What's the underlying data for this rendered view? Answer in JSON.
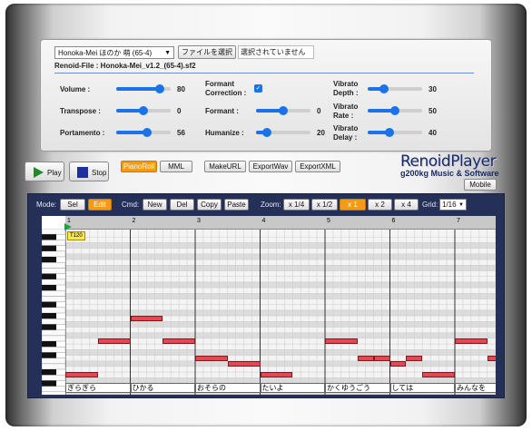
{
  "file": {
    "selected": "Honoka-Mei ほのか 萌 (65-4)",
    "choose_label": "ファイルを選択",
    "status": "選択されていません",
    "renoid_file": "Renoid-File : Honoka-Mei_v1.2_(65-4).sf2"
  },
  "params": [
    {
      "label": "Volume :",
      "value": "80",
      "level": 0.8
    },
    {
      "label": "Transpose :",
      "value": "0",
      "level": 0.5
    },
    {
      "label": "Portamento :",
      "value": "56",
      "level": 0.56
    },
    {
      "label": "Formant Correction :",
      "checked": true
    },
    {
      "label": "Formant :",
      "value": "0",
      "level": 0.5
    },
    {
      "label": "Humanize :",
      "value": "20",
      "level": 0.2
    },
    {
      "label": "Vibrato Depth :",
      "value": "30",
      "level": 0.3
    },
    {
      "label": "Vibrato Rate :",
      "value": "50",
      "level": 0.5
    },
    {
      "label": "Vibrato Delay :",
      "value": "40",
      "level": 0.4
    }
  ],
  "transport": {
    "play": "Play",
    "stop": "Stop"
  },
  "buttons": {
    "pianoroll": "PianoRoll",
    "mml": "MML",
    "makeurl": "MakeURL",
    "exportwav": "ExportWav",
    "exportxml": "ExportXML",
    "mobile": "Mobile"
  },
  "logo": {
    "title": "RenoidPlayer",
    "subtitle": "g200kg Music & Software"
  },
  "toolbar": {
    "mode_label": "Mode:",
    "mode_sel": "Sel",
    "mode_edit": "Edit",
    "cmd_label": "Cmd:",
    "new": "New",
    "del": "Del",
    "copy": "Copy",
    "paste": "Paste",
    "zoom_label": "Zoom:",
    "zoom": [
      "x 1/4",
      "x 1/2",
      "x 1",
      "x 2",
      "x 4"
    ],
    "zoom_active": 2,
    "grid_label": "Grid:",
    "grid_value": "1/16"
  },
  "roll": {
    "bars": [
      "1",
      "2",
      "3",
      "4",
      "5",
      "6",
      "7"
    ],
    "tempo": "T120",
    "octaves": [
      "C5",
      "C4"
    ],
    "notes": [
      {
        "bar": 1,
        "beat": 0,
        "len": 1,
        "pitch": "B3"
      },
      {
        "bar": 1,
        "beat": 1,
        "len": 1,
        "pitch": "F4"
      },
      {
        "bar": 2,
        "beat": 0,
        "len": 1,
        "pitch": "A4"
      },
      {
        "bar": 2,
        "beat": 1,
        "len": 1,
        "pitch": "F4"
      },
      {
        "bar": 3,
        "beat": 0,
        "len": 1,
        "pitch": "D4"
      },
      {
        "bar": 3,
        "beat": 1,
        "len": 1,
        "pitch": "C#4"
      },
      {
        "bar": 4,
        "beat": 0,
        "len": 1,
        "pitch": "B3"
      },
      {
        "bar": 4,
        "beat": 1,
        "len": 1,
        "pitch": "A3"
      },
      {
        "bar": 5,
        "beat": 0,
        "len": 1,
        "pitch": "F4"
      },
      {
        "bar": 5,
        "beat": 1,
        "len": 0.5,
        "pitch": "D4"
      },
      {
        "bar": 5,
        "beat": 1.5,
        "len": 0.5,
        "pitch": "D4"
      },
      {
        "bar": 6,
        "beat": 0,
        "len": 0.5,
        "pitch": "C#4"
      },
      {
        "bar": 6,
        "beat": 0.5,
        "len": 0.5,
        "pitch": "D4"
      },
      {
        "bar": 6,
        "beat": 1,
        "len": 1,
        "pitch": "B3"
      },
      {
        "bar": 7,
        "beat": 0,
        "len": 1,
        "pitch": "F4"
      },
      {
        "bar": 7,
        "beat": 1,
        "len": 0.5,
        "pitch": "D4"
      }
    ],
    "lyrics": [
      "ぎらぎら",
      "ひかる",
      "おそらの",
      "たいよ",
      "かくゆうごう",
      "しては",
      "みんなを"
    ]
  }
}
